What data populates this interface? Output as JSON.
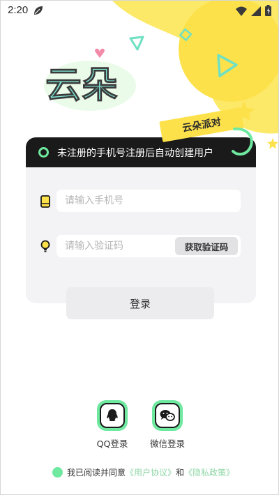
{
  "status_bar": {
    "time": "2:20"
  },
  "brand": {
    "logo_text": "云朵",
    "tag": "云朵派对"
  },
  "notice": "未注册的手机号注册后自动创建用户",
  "phone": {
    "placeholder": "请输入手机号",
    "value": ""
  },
  "code": {
    "placeholder": "请输入验证码",
    "value": "",
    "button": "获取验证码"
  },
  "login_button": "登录",
  "social": {
    "qq": "QQ登录",
    "wechat": "微信登录"
  },
  "agreement": {
    "text": "我已阅读并同意",
    "user_agreement": "《用户协议》",
    "and": "和",
    "privacy_policy": "《隐私政策》"
  },
  "colors": {
    "accent_green": "#6fe9a0",
    "accent_yellow": "#fde14b",
    "dark": "#1a1a1a"
  },
  "icons": [
    "leaf-icon",
    "wifi-icon",
    "signal-icon",
    "battery-icon",
    "phone-icon",
    "bulb-icon",
    "qq-icon",
    "wechat-icon"
  ]
}
